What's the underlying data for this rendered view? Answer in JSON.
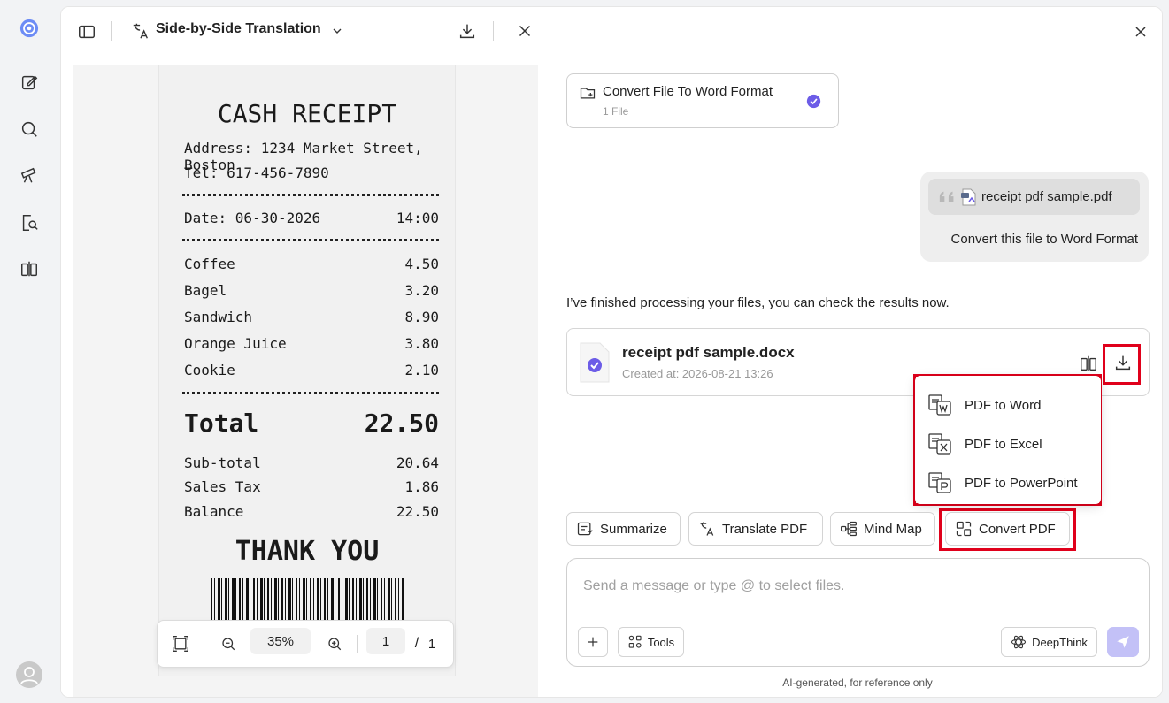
{
  "rail": {
    "icons": [
      "logo-icon",
      "edit-icon",
      "search-icon",
      "telescope-icon",
      "doc-search-icon",
      "compare-icon",
      "user-avatar-icon"
    ]
  },
  "doc_toolbar": {
    "mode_label": "Side-by-Side Translation"
  },
  "receipt": {
    "title": "CASH RECEIPT",
    "address": "Address: 1234 Market Street, Boston",
    "tel": "Tel: 617-456-7890",
    "date": "Date: 06-30-2026",
    "time": "14:00",
    "items": [
      {
        "name": "Coffee",
        "price": "4.50"
      },
      {
        "name": "Bagel",
        "price": "3.20"
      },
      {
        "name": "Sandwich",
        "price": "8.90"
      },
      {
        "name": "Orange Juice",
        "price": "3.80"
      },
      {
        "name": "Cookie",
        "price": "2.10"
      }
    ],
    "total_label": "Total",
    "total_value": "22.50",
    "subtotal_label": "Sub-total",
    "subtotal_value": "20.64",
    "tax_label": "Sales Tax",
    "tax_value": "1.86",
    "balance_label": "Balance",
    "balance_value": "22.50",
    "thanks": "THANK YOU"
  },
  "zoom": {
    "level": "35%",
    "page": "1",
    "separator": "/",
    "total_pages": "1"
  },
  "chat": {
    "task": {
      "title": "Convert File To Word Format",
      "subtitle": "1 File"
    },
    "user_message": {
      "attachment": "receipt pdf sample.pdf",
      "text": "Convert this file to Word Format"
    },
    "reply": "I’ve finished processing your files, you can check the results now.",
    "result_file": {
      "name": "receipt pdf sample.docx",
      "created": "Created at: 2026-08-21 13:26"
    },
    "download_menu": [
      {
        "label": "PDF to Word",
        "icon": "pdf-to-word-icon"
      },
      {
        "label": "PDF to Excel",
        "icon": "pdf-to-excel-icon"
      },
      {
        "label": "PDF to PowerPoint",
        "icon": "pdf-to-powerpoint-icon"
      }
    ],
    "quick_actions": [
      {
        "label": "Summarize"
      },
      {
        "label": "Translate PDF"
      },
      {
        "label": "Mind Map"
      },
      {
        "label": "Convert PDF"
      }
    ],
    "input_placeholder": "Send a message or type @ to select files.",
    "tools_label": "Tools",
    "deepthink_label": "DeepThink",
    "footnote": "AI-generated, for reference only"
  },
  "colors": {
    "accent": "#6c5ce7",
    "highlight": "#e0001b",
    "send_disabled": "#c3c1f7"
  }
}
